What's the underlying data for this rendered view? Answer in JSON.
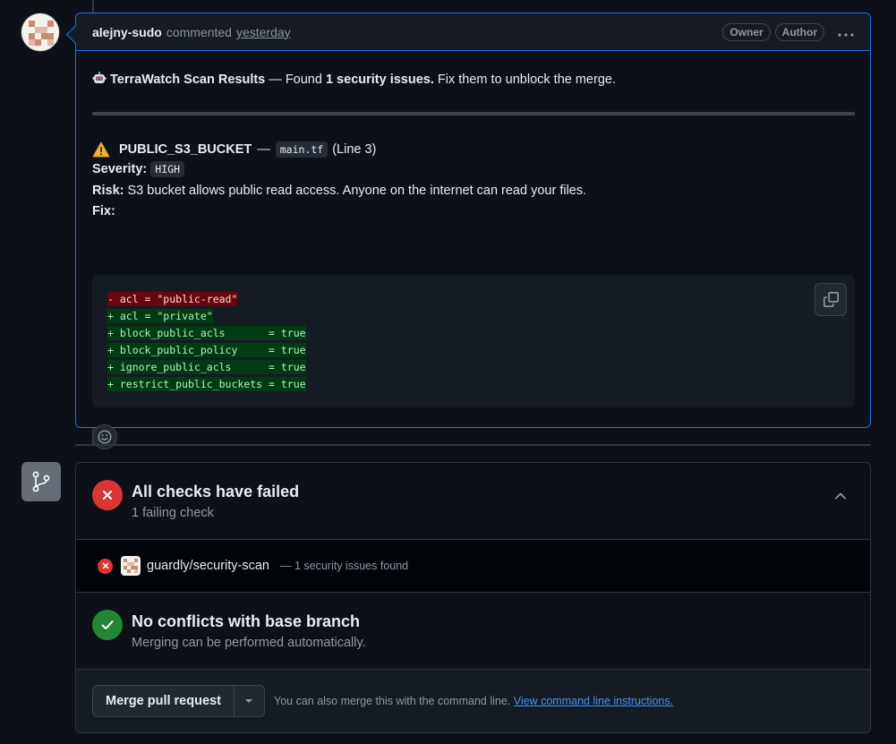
{
  "comment": {
    "author": "alejny-sudo",
    "action": "commented",
    "time": "yesterday",
    "badges": [
      "Owner",
      "Author"
    ],
    "summary": {
      "bold_title": "TerraWatch Scan Results",
      "dash": "—",
      "found_prefix": "Found",
      "found_bold": "1 security issues.",
      "rest": "Fix them to unblock the merge."
    },
    "issue": {
      "rule": "PUBLIC_S3_BUCKET",
      "dash": "—",
      "file": "main.tf",
      "line": "(Line 3)",
      "severity_label": "Severity:",
      "severity_value": "HIGH",
      "risk_label": "Risk:",
      "risk_text": "S3 bucket allows public read access. Anyone on the internet can read your files.",
      "fix_label": "Fix:"
    },
    "code_lines": [
      {
        "type": "del",
        "text": "- acl = \"public-read\""
      },
      {
        "type": "add",
        "text": "+ acl = \"private\""
      },
      {
        "type": "add",
        "text": "+ block_public_acls       = true"
      },
      {
        "type": "add",
        "text": "+ block_public_policy     = true"
      },
      {
        "type": "add",
        "text": "+ ignore_public_acls      = true"
      },
      {
        "type": "add",
        "text": "+ restrict_public_buckets = true"
      }
    ]
  },
  "checks": {
    "title": "All checks have failed",
    "subtitle": "1 failing check",
    "row": {
      "name": "guardly/security-scan",
      "desc": "— 1 security issues found"
    }
  },
  "conflicts": {
    "title": "No conflicts with base branch",
    "subtitle": "Merging can be performed automatically."
  },
  "merge": {
    "button": "Merge pull request",
    "hint": "You can also merge this with the command line.",
    "link": "View command line instructions."
  },
  "colors": {
    "accent_border": "#1f6feb",
    "fail": "#da3633",
    "success": "#238636",
    "link": "#4493f8"
  },
  "icons": [
    "avatar",
    "robot-icon",
    "warning-icon",
    "copy-icon",
    "smiley-icon",
    "git-branch-icon",
    "x-icon",
    "check-icon",
    "chevron-up-icon",
    "caret-down-icon",
    "kebab-icon"
  ]
}
